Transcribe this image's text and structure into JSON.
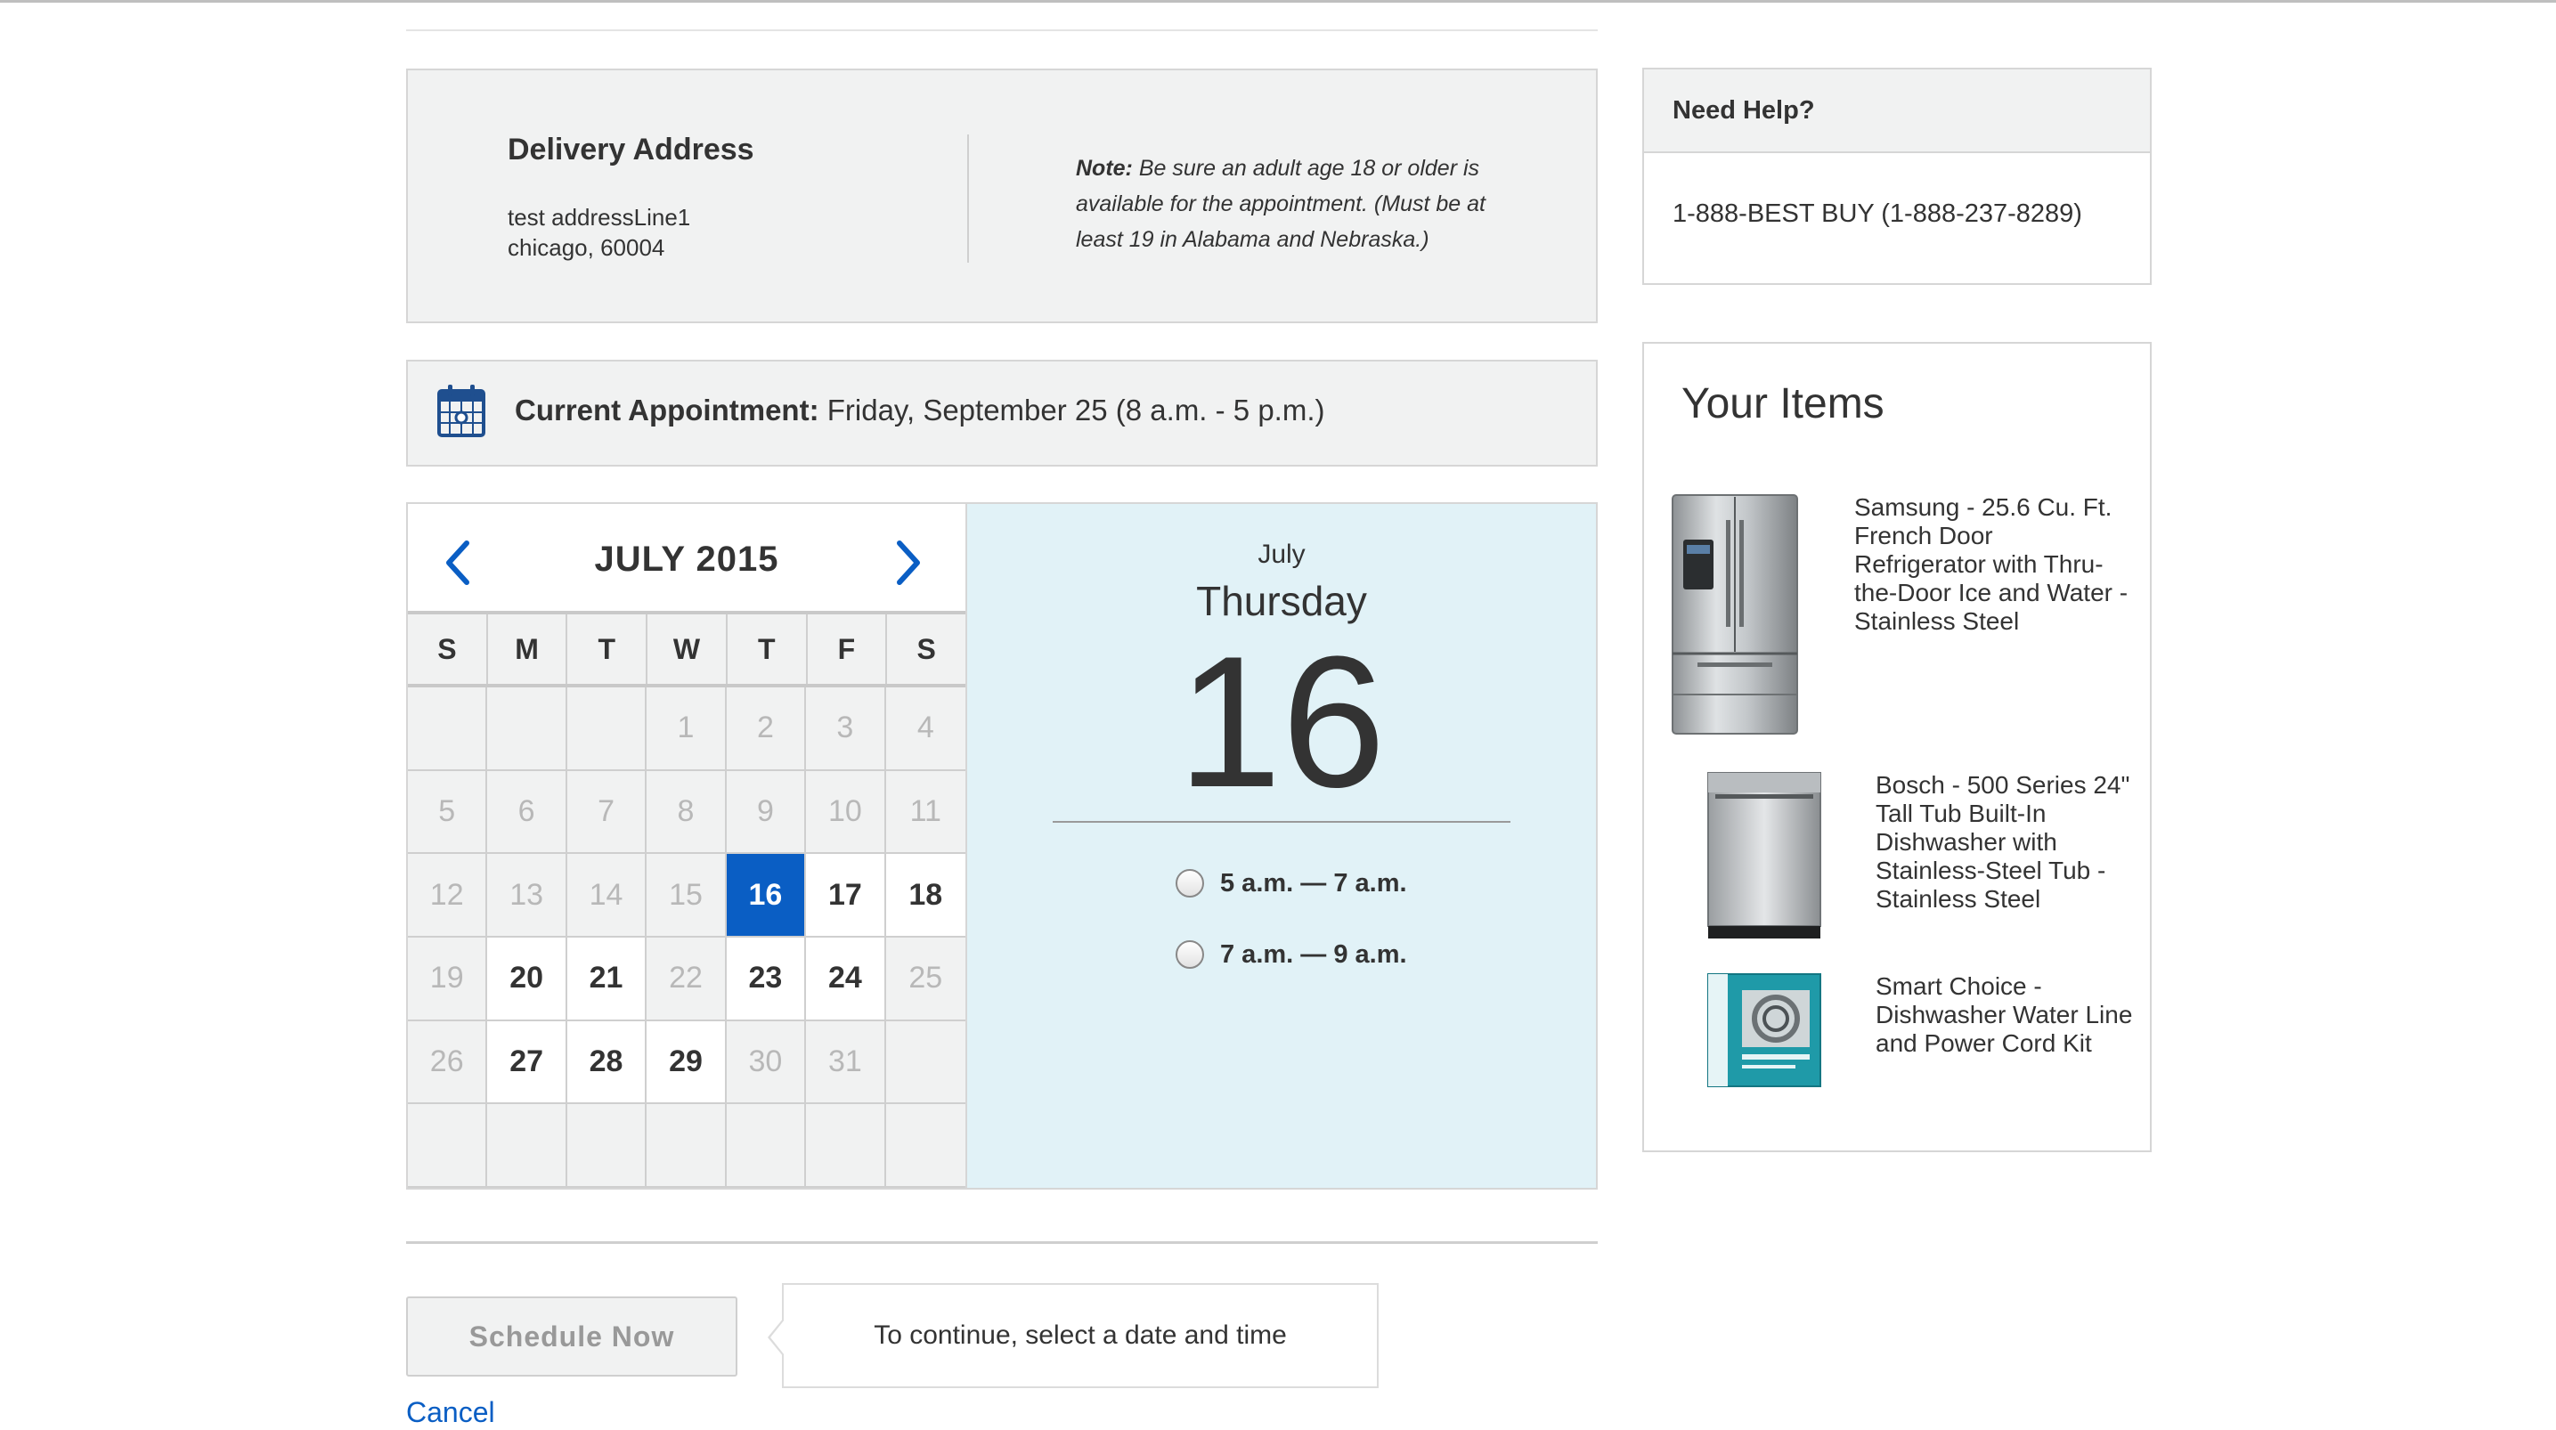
{
  "delivery": {
    "title": "Delivery Address",
    "line1": "test addressLine1",
    "line2": "chicago, 60004",
    "note_label": "Note:",
    "note_text": " Be sure an adult age 18 or older is available for the appointment. (Must be at least 19 in Alabama and Nebraska.)"
  },
  "appointment": {
    "label": "Current Appointment:",
    "value": " Friday, September 25 (8 a.m. - 5 p.m.)"
  },
  "calendar": {
    "month_title": "JULY 2015",
    "weekdays": [
      "S",
      "M",
      "T",
      "W",
      "T",
      "F",
      "S"
    ],
    "days": [
      {
        "label": "",
        "state": "empty"
      },
      {
        "label": "",
        "state": "empty"
      },
      {
        "label": "",
        "state": "empty"
      },
      {
        "label": "1",
        "state": "disabled"
      },
      {
        "label": "2",
        "state": "disabled"
      },
      {
        "label": "3",
        "state": "disabled"
      },
      {
        "label": "4",
        "state": "disabled"
      },
      {
        "label": "5",
        "state": "disabled"
      },
      {
        "label": "6",
        "state": "disabled"
      },
      {
        "label": "7",
        "state": "disabled"
      },
      {
        "label": "8",
        "state": "disabled"
      },
      {
        "label": "9",
        "state": "disabled"
      },
      {
        "label": "10",
        "state": "disabled"
      },
      {
        "label": "11",
        "state": "disabled"
      },
      {
        "label": "12",
        "state": "disabled"
      },
      {
        "label": "13",
        "state": "disabled"
      },
      {
        "label": "14",
        "state": "disabled"
      },
      {
        "label": "15",
        "state": "disabled"
      },
      {
        "label": "16",
        "state": "selected"
      },
      {
        "label": "17",
        "state": "available"
      },
      {
        "label": "18",
        "state": "available"
      },
      {
        "label": "19",
        "state": "disabled"
      },
      {
        "label": "20",
        "state": "available"
      },
      {
        "label": "21",
        "state": "available"
      },
      {
        "label": "22",
        "state": "disabled"
      },
      {
        "label": "23",
        "state": "available"
      },
      {
        "label": "24",
        "state": "available"
      },
      {
        "label": "25",
        "state": "disabled"
      },
      {
        "label": "26",
        "state": "disabled"
      },
      {
        "label": "27",
        "state": "available"
      },
      {
        "label": "28",
        "state": "available"
      },
      {
        "label": "29",
        "state": "available"
      },
      {
        "label": "30",
        "state": "disabled"
      },
      {
        "label": "31",
        "state": "disabled"
      },
      {
        "label": "",
        "state": "empty"
      },
      {
        "label": "",
        "state": "empty"
      },
      {
        "label": "",
        "state": "empty"
      },
      {
        "label": "",
        "state": "empty"
      },
      {
        "label": "",
        "state": "empty"
      },
      {
        "label": "",
        "state": "empty"
      },
      {
        "label": "",
        "state": "empty"
      },
      {
        "label": "",
        "state": "empty"
      }
    ]
  },
  "selected_date": {
    "month": "July",
    "weekday": "Thursday",
    "day": "16",
    "slots": [
      "5 a.m. — 7 a.m.",
      "7 a.m. — 9 a.m."
    ]
  },
  "actions": {
    "schedule_label": "Schedule Now",
    "hint": "To continue, select a date and time",
    "cancel_label": "Cancel"
  },
  "help": {
    "title": "Need Help?",
    "phone": "1-888-BEST BUY (1-888-237-8289)"
  },
  "items": {
    "title": "Your Items",
    "list": [
      {
        "name": "Samsung - 25.6 Cu. Ft. French Door Refrigerator with Thru-the-Door Ice and Water - Stainless Steel"
      },
      {
        "name": "Bosch - 500 Series 24\" Tall Tub Built-In Dishwasher with Stainless-Steel Tub - Stainless Steel"
      },
      {
        "name": "Smart Choice - Dishwasher Water Line and Power Cord Kit"
      }
    ]
  },
  "colors": {
    "accent_blue": "#0a5ec4",
    "panel_gray": "#f1f2f2",
    "date_panel_blue": "#e1f2f7"
  }
}
